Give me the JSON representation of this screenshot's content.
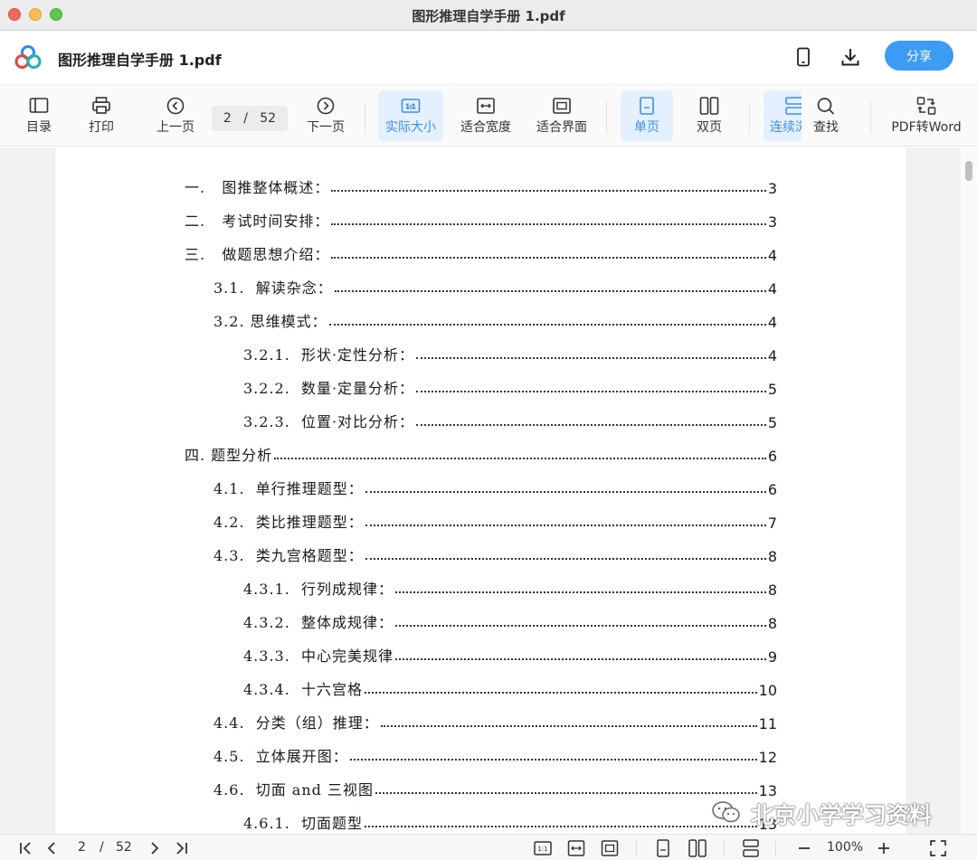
{
  "window": {
    "title": "图形推理自学手册 1.pdf"
  },
  "header": {
    "doc_title": "图形推理自学手册 1.pdf",
    "share_label": "分享"
  },
  "toolbar": {
    "catalog": "目录",
    "print": "打印",
    "prev": "上一页",
    "current_page": "2",
    "page_sep": "/",
    "total_pages": "52",
    "next": "下一页",
    "actual_size": "实际大小",
    "fit_width": "适合宽度",
    "fit_page": "适合界面",
    "single_page": "单页",
    "double_page": "双页",
    "continuous": "连续浏览",
    "search": "查找",
    "pdf_to_word": "PDF转Word",
    "active_tools": [
      "actual_size",
      "single_page",
      "continuous"
    ]
  },
  "toc": [
    {
      "text": "一.   图推整体概述：",
      "page": "3"
    },
    {
      "text": "二.   考试时间安排：",
      "page": "3"
    },
    {
      "text": "三.   做题思想介绍：",
      "page": "4"
    },
    {
      "text": "3.1.  解读杂念：",
      "page": "4"
    },
    {
      "text": "3.2. 思维模式：",
      "page": "4"
    },
    {
      "text": "3.2.1.  形状·定性分析：",
      "page": "4"
    },
    {
      "text": "3.2.2.  数量·定量分析：",
      "page": "5"
    },
    {
      "text": "3.2.3.  位置·对比分析：",
      "page": "5"
    },
    {
      "text": "四. 题型分析",
      "page": "6"
    },
    {
      "text": "4.1.  单行推理题型：",
      "page": "6"
    },
    {
      "text": "4.2.  类比推理题型：",
      "page": "7"
    },
    {
      "text": "4.3.  类九宫格题型：",
      "page": "8"
    },
    {
      "text": "4.3.1.  行列成规律：",
      "page": "8"
    },
    {
      "text": "4.3.2.  整体成规律：",
      "page": "8"
    },
    {
      "text": "4.3.3.  中心完美规律",
      "page": "9"
    },
    {
      "text": "4.3.4.  十六宫格",
      "page": "10"
    },
    {
      "text": "4.4.  分类（组）推理：",
      "page": "11"
    },
    {
      "text": "4.5.  立体展开图：",
      "page": "12"
    },
    {
      "text": "4.6.  切面 and 三视图",
      "page": "13"
    },
    {
      "text": "4.6.1.  切面题型",
      "page": "13"
    }
  ],
  "watermark": "北京小学学习资料",
  "bottombar": {
    "current_page": "2",
    "page_sep": "/",
    "total_pages": "52",
    "zoom": "100%"
  },
  "colors": {
    "accent": "#3d8ff0",
    "share_button": "#3c9cf3"
  },
  "icons": [
    "logo-icon",
    "phone-icon",
    "download-icon",
    "catalog-icon",
    "print-icon",
    "prev-page-icon",
    "next-page-icon",
    "actual-size-icon",
    "fit-width-icon",
    "fit-page-icon",
    "single-page-icon",
    "double-page-icon",
    "continuous-icon",
    "search-icon",
    "pdf-to-word-icon"
  ]
}
